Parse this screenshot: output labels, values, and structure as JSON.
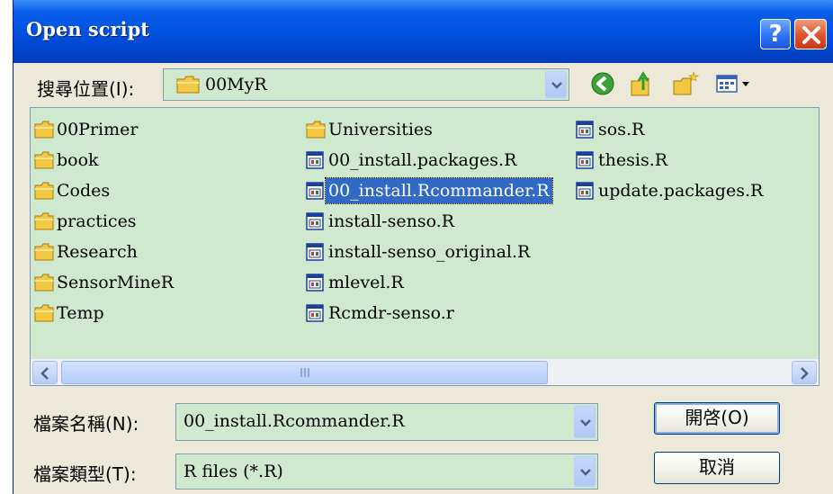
{
  "window": {
    "title": "Open script"
  },
  "titlebar": {
    "help_glyph": "?"
  },
  "look_in": {
    "label": "搜尋位置(I):",
    "value": "00MyR"
  },
  "toolbar_icons": [
    "back-icon",
    "up-folder-icon",
    "new-folder-icon",
    "view-menu-icon"
  ],
  "files": [
    {
      "name": "00Primer",
      "type": "folder"
    },
    {
      "name": "book",
      "type": "folder"
    },
    {
      "name": "Codes",
      "type": "folder"
    },
    {
      "name": "practices",
      "type": "folder"
    },
    {
      "name": "Research",
      "type": "folder"
    },
    {
      "name": "SensorMineR",
      "type": "folder"
    },
    {
      "name": "Temp",
      "type": "folder"
    },
    {
      "name": "Universities",
      "type": "folder"
    },
    {
      "name": "00_install.packages.R",
      "type": "file"
    },
    {
      "name": "00_install.Rcommander.R",
      "type": "file",
      "selected": true
    },
    {
      "name": "install-senso.R",
      "type": "file"
    },
    {
      "name": "install-senso_original.R",
      "type": "file"
    },
    {
      "name": "mlevel.R",
      "type": "file"
    },
    {
      "name": "Rcmdr-senso.r",
      "type": "file"
    },
    {
      "name": "sos.R",
      "type": "file"
    },
    {
      "name": "thesis.R",
      "type": "file"
    },
    {
      "name": "update.packages.R",
      "type": "file"
    }
  ],
  "scrollbar": {
    "thumb_fraction": 0.67,
    "position": 0.0
  },
  "file_name": {
    "label": "檔案名稱(N):",
    "value": "00_install.Rcommander.R"
  },
  "file_type": {
    "label": "檔案類型(T):",
    "value": "R files (*.R)"
  },
  "buttons": {
    "open_label": "開啓(O)",
    "cancel_label": "取消"
  },
  "colors": {
    "title_bar": "#0054e3",
    "list_background": "#cfe9cf",
    "selection": "#316ac5",
    "folder_yellow": "#f5c842"
  }
}
